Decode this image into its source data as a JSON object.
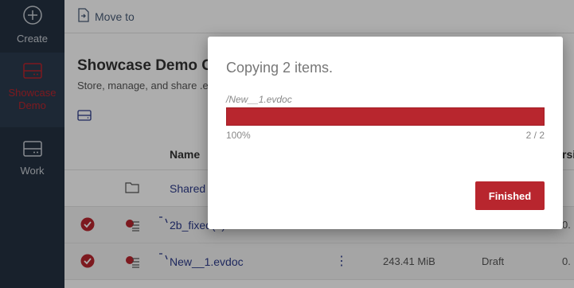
{
  "sidebar": {
    "items": [
      {
        "label": "Create",
        "icon": "plus-circle-icon"
      },
      {
        "label": "Showcase Demo",
        "icon": "showcase-drive-icon",
        "active": true
      },
      {
        "label": "Work",
        "icon": "work-drive-icon"
      }
    ]
  },
  "toolbar": {
    "move_label": "Move to"
  },
  "page": {
    "title": "Showcase Demo C",
    "subtitle": "Store, manage, and share .e"
  },
  "table": {
    "headers": {
      "name": "Name",
      "version": "rsi"
    },
    "rows": [
      {
        "name": "Shared",
        "type": "folder",
        "checked": false
      },
      {
        "name": "2b_fixed(1)",
        "type": "evdoc",
        "checked": true,
        "size": "",
        "status": "",
        "version": "0."
      },
      {
        "name": "New__1.evdoc",
        "type": "evdoc",
        "checked": true,
        "size": "243.41 MiB",
        "status": "Draft",
        "version": "0."
      }
    ]
  },
  "modal": {
    "title": "Copying 2 items.",
    "current_file": "/New__1.evdoc",
    "progress": 1.0,
    "percent_label": "100%",
    "count_label": "2 / 2",
    "finish_label": "Finished"
  },
  "colors": {
    "accent": "#b8262e",
    "sidebar_bg": "#243142",
    "link": "#2c3a8a"
  }
}
